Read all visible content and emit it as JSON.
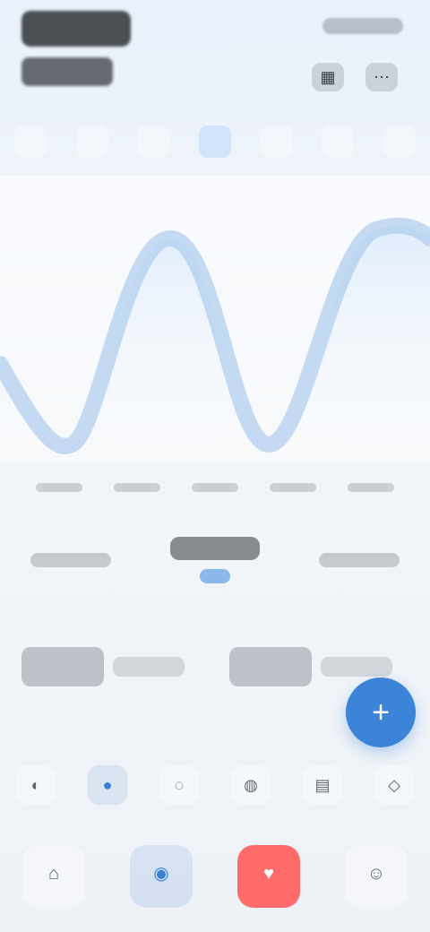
{
  "header": {
    "title": "",
    "subtitle": "",
    "top_right": "",
    "icons": [
      {
        "name": "calendar-icon",
        "glyph": "▦"
      },
      {
        "name": "more-icon",
        "glyph": "⋯"
      }
    ]
  },
  "week": {
    "days": [
      {
        "label": "",
        "active": false
      },
      {
        "label": "",
        "active": false
      },
      {
        "label": "",
        "active": false
      },
      {
        "label": "",
        "active": true
      },
      {
        "label": "",
        "active": false
      },
      {
        "label": "",
        "active": false
      },
      {
        "label": "",
        "active": false
      }
    ]
  },
  "chart": {
    "tick_labels": [
      "",
      "",
      "",
      "",
      ""
    ]
  },
  "stats": [
    {
      "label": "",
      "badge": ""
    },
    {
      "label": "",
      "badge": ""
    },
    {
      "label": "",
      "badge": ""
    }
  ],
  "summary": [
    {
      "primary": "",
      "secondary": ""
    },
    {
      "primary": "",
      "secondary": ""
    }
  ],
  "fab": {
    "glyph": "+"
  },
  "toolbar": {
    "items": [
      {
        "name": "toolbar-item-1",
        "glyph": "◐",
        "active": false
      },
      {
        "name": "toolbar-item-2",
        "glyph": "●",
        "active": true
      },
      {
        "name": "toolbar-item-3",
        "glyph": "◌",
        "active": false
      },
      {
        "name": "toolbar-item-4",
        "glyph": "◍",
        "active": false
      },
      {
        "name": "toolbar-item-5",
        "glyph": "▤",
        "active": false
      },
      {
        "name": "toolbar-item-6",
        "glyph": "◇",
        "active": false
      }
    ]
  },
  "bottom_nav": {
    "items": [
      {
        "name": "nav-home",
        "glyph": "⌂",
        "label": "",
        "state": "normal"
      },
      {
        "name": "nav-active",
        "glyph": "◉",
        "label": "",
        "state": "active"
      },
      {
        "name": "nav-alert",
        "glyph": "♥",
        "label": "",
        "state": "alert"
      },
      {
        "name": "nav-profile",
        "glyph": "☺",
        "label": "",
        "state": "normal"
      }
    ]
  },
  "colors": {
    "accent": "#3c84d7",
    "alert": "#ff6b6b",
    "wave": "#a9c9ec"
  }
}
